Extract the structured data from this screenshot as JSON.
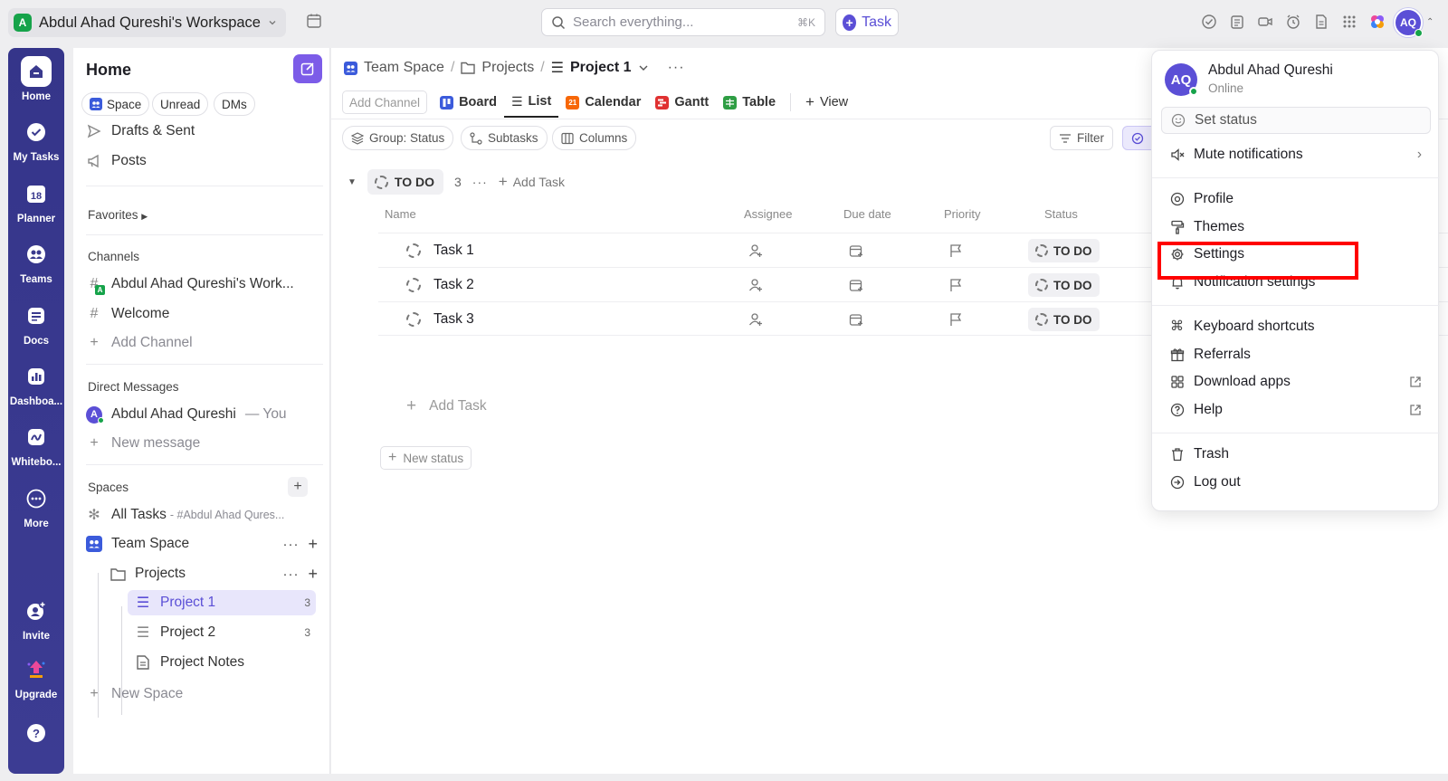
{
  "topbar": {
    "workspace_badge": "A",
    "workspace_name": "Abdul Ahad Qureshi's Workspace",
    "search_placeholder": "Search everything...",
    "search_shortcut": "⌘K",
    "task_button": "Task",
    "avatar_initials": "AQ"
  },
  "rail": {
    "items": [
      {
        "label": "Home",
        "icon": "home-icon"
      },
      {
        "label": "My Tasks",
        "icon": "check-circle-icon"
      },
      {
        "label": "Planner",
        "icon": "calendar-icon",
        "badge": "18"
      },
      {
        "label": "Teams",
        "icon": "teams-icon"
      },
      {
        "label": "Docs",
        "icon": "doc-icon"
      },
      {
        "label": "Dashboa...",
        "icon": "dashboard-icon"
      },
      {
        "label": "Whitebo...",
        "icon": "whiteboard-icon"
      },
      {
        "label": "More",
        "icon": "more-icon"
      },
      {
        "label": "Invite",
        "icon": "invite-icon"
      },
      {
        "label": "Upgrade",
        "icon": "upgrade-icon"
      },
      {
        "label": "",
        "icon": "help-icon"
      }
    ]
  },
  "sidebar": {
    "title": "Home",
    "chips": [
      "Space",
      "Unread",
      "DMs"
    ],
    "drafts": "Drafts & Sent",
    "posts": "Posts",
    "favorites": "Favorites",
    "channels_header": "Channels",
    "channels": [
      "Abdul Ahad Qureshi's Work...",
      "Welcome"
    ],
    "add_channel": "Add Channel",
    "dm_header": "Direct Messages",
    "dm_user": "Abdul Ahad Qureshi",
    "dm_you": "— You",
    "dm_avatar": "A",
    "new_message": "New message",
    "spaces_header": "Spaces",
    "all_tasks": "All Tasks",
    "all_tasks_sub": "- #Abdul Ahad Qures...",
    "team_space": "Team Space",
    "projects": "Projects",
    "project1": "Project 1",
    "project1_count": "3",
    "project2": "Project 2",
    "project2_count": "3",
    "project_notes": "Project Notes",
    "new_space": "New Space"
  },
  "main": {
    "breadcrumb": [
      "Team Space",
      "Projects",
      "Project 1"
    ],
    "tabs": {
      "add_channel": "Add Channel",
      "board": "Board",
      "list": "List",
      "calendar": "Calendar",
      "calendar_day": "21",
      "gantt": "Gantt",
      "table": "Table",
      "view": "View"
    },
    "toolbar": {
      "group": "Group: Status",
      "subtasks": "Subtasks",
      "columns": "Columns",
      "filter": "Filter"
    },
    "group": {
      "status": "TO DO",
      "count": "3",
      "add_task": "Add Task"
    },
    "columns": [
      "Name",
      "Assignee",
      "Due date",
      "Priority",
      "Status"
    ],
    "tasks": [
      {
        "name": "Task 1",
        "status": "TO DO"
      },
      {
        "name": "Task 2",
        "status": "TO DO"
      },
      {
        "name": "Task 3",
        "status": "TO DO"
      }
    ],
    "add_task": "Add Task",
    "new_status": "New status"
  },
  "menu": {
    "avatar": "AQ",
    "name": "Abdul Ahad Qureshi",
    "state": "Online",
    "set_status": "Set status",
    "mute": "Mute notifications",
    "profile": "Profile",
    "themes": "Themes",
    "settings": "Settings",
    "notification_settings": "Notification settings",
    "keyboard": "Keyboard shortcuts",
    "referrals": "Referrals",
    "download": "Download apps",
    "help": "Help",
    "trash": "Trash",
    "logout": "Log out"
  },
  "colors": {
    "accent": "#5b4fd6",
    "rail": "#3a3a8e",
    "highlight": "#ff0000"
  }
}
